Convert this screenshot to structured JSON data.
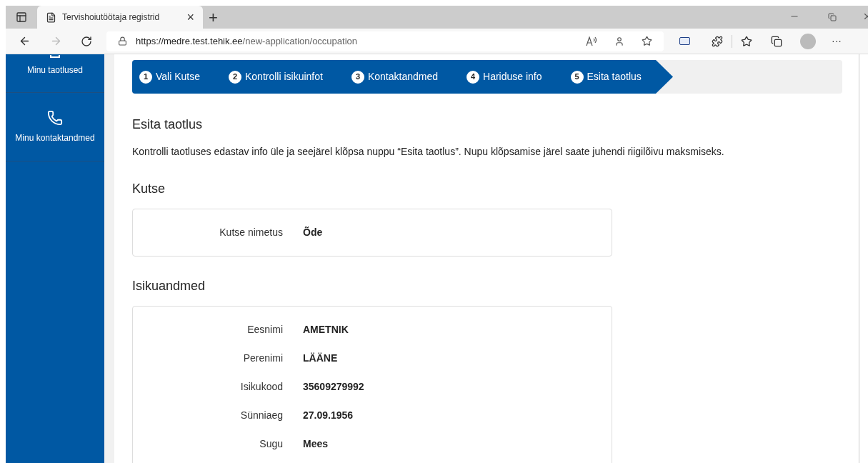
{
  "browser": {
    "tab_title": "Tervishoiutöötaja registrid",
    "tab_close": "×",
    "new_tab": "+",
    "url_host": "https://medre.test.tehik.ee",
    "url_path": "/new-application/occupation",
    "more": "···"
  },
  "sidebar": {
    "items": [
      {
        "label": "Minu taotlused",
        "kind": "cut"
      },
      {
        "label": "Minu kontaktandmed",
        "kind": "phone"
      }
    ]
  },
  "steps": [
    {
      "number": "1",
      "label": "Vali Kutse",
      "completed": true
    },
    {
      "number": "2",
      "label": "Kontrolli isikuinfot",
      "completed": true
    },
    {
      "number": "3",
      "label": "Kontaktandmed",
      "completed": true
    },
    {
      "number": "4",
      "label": "Hariduse info",
      "completed": true
    },
    {
      "number": "5",
      "label": "Esita taotlus",
      "completed": true
    }
  ],
  "title": "Esita taotlus",
  "intro": "Kontrolli taotluses edastav info üle ja seejärel klõpsa nuppu “Esita taotlus”. Nupu klõpsamise järel saate juhendi riigilõivu maksmiseks.",
  "sections": [
    {
      "heading": "Kutse",
      "fields": [
        {
          "label": "Kutse nimetus",
          "value": "Õde"
        }
      ]
    },
    {
      "heading": "Isikuandmed",
      "fields": [
        {
          "label": "Eesnimi",
          "value": "AMETNIK"
        },
        {
          "label": "Perenimi",
          "value": "LÄÄNE"
        },
        {
          "label": "Isikukood",
          "value": "35609279992"
        },
        {
          "label": "Sünniaeg",
          "value": "27.09.1956"
        },
        {
          "label": "Sugu",
          "value": "Mees"
        }
      ]
    }
  ]
}
